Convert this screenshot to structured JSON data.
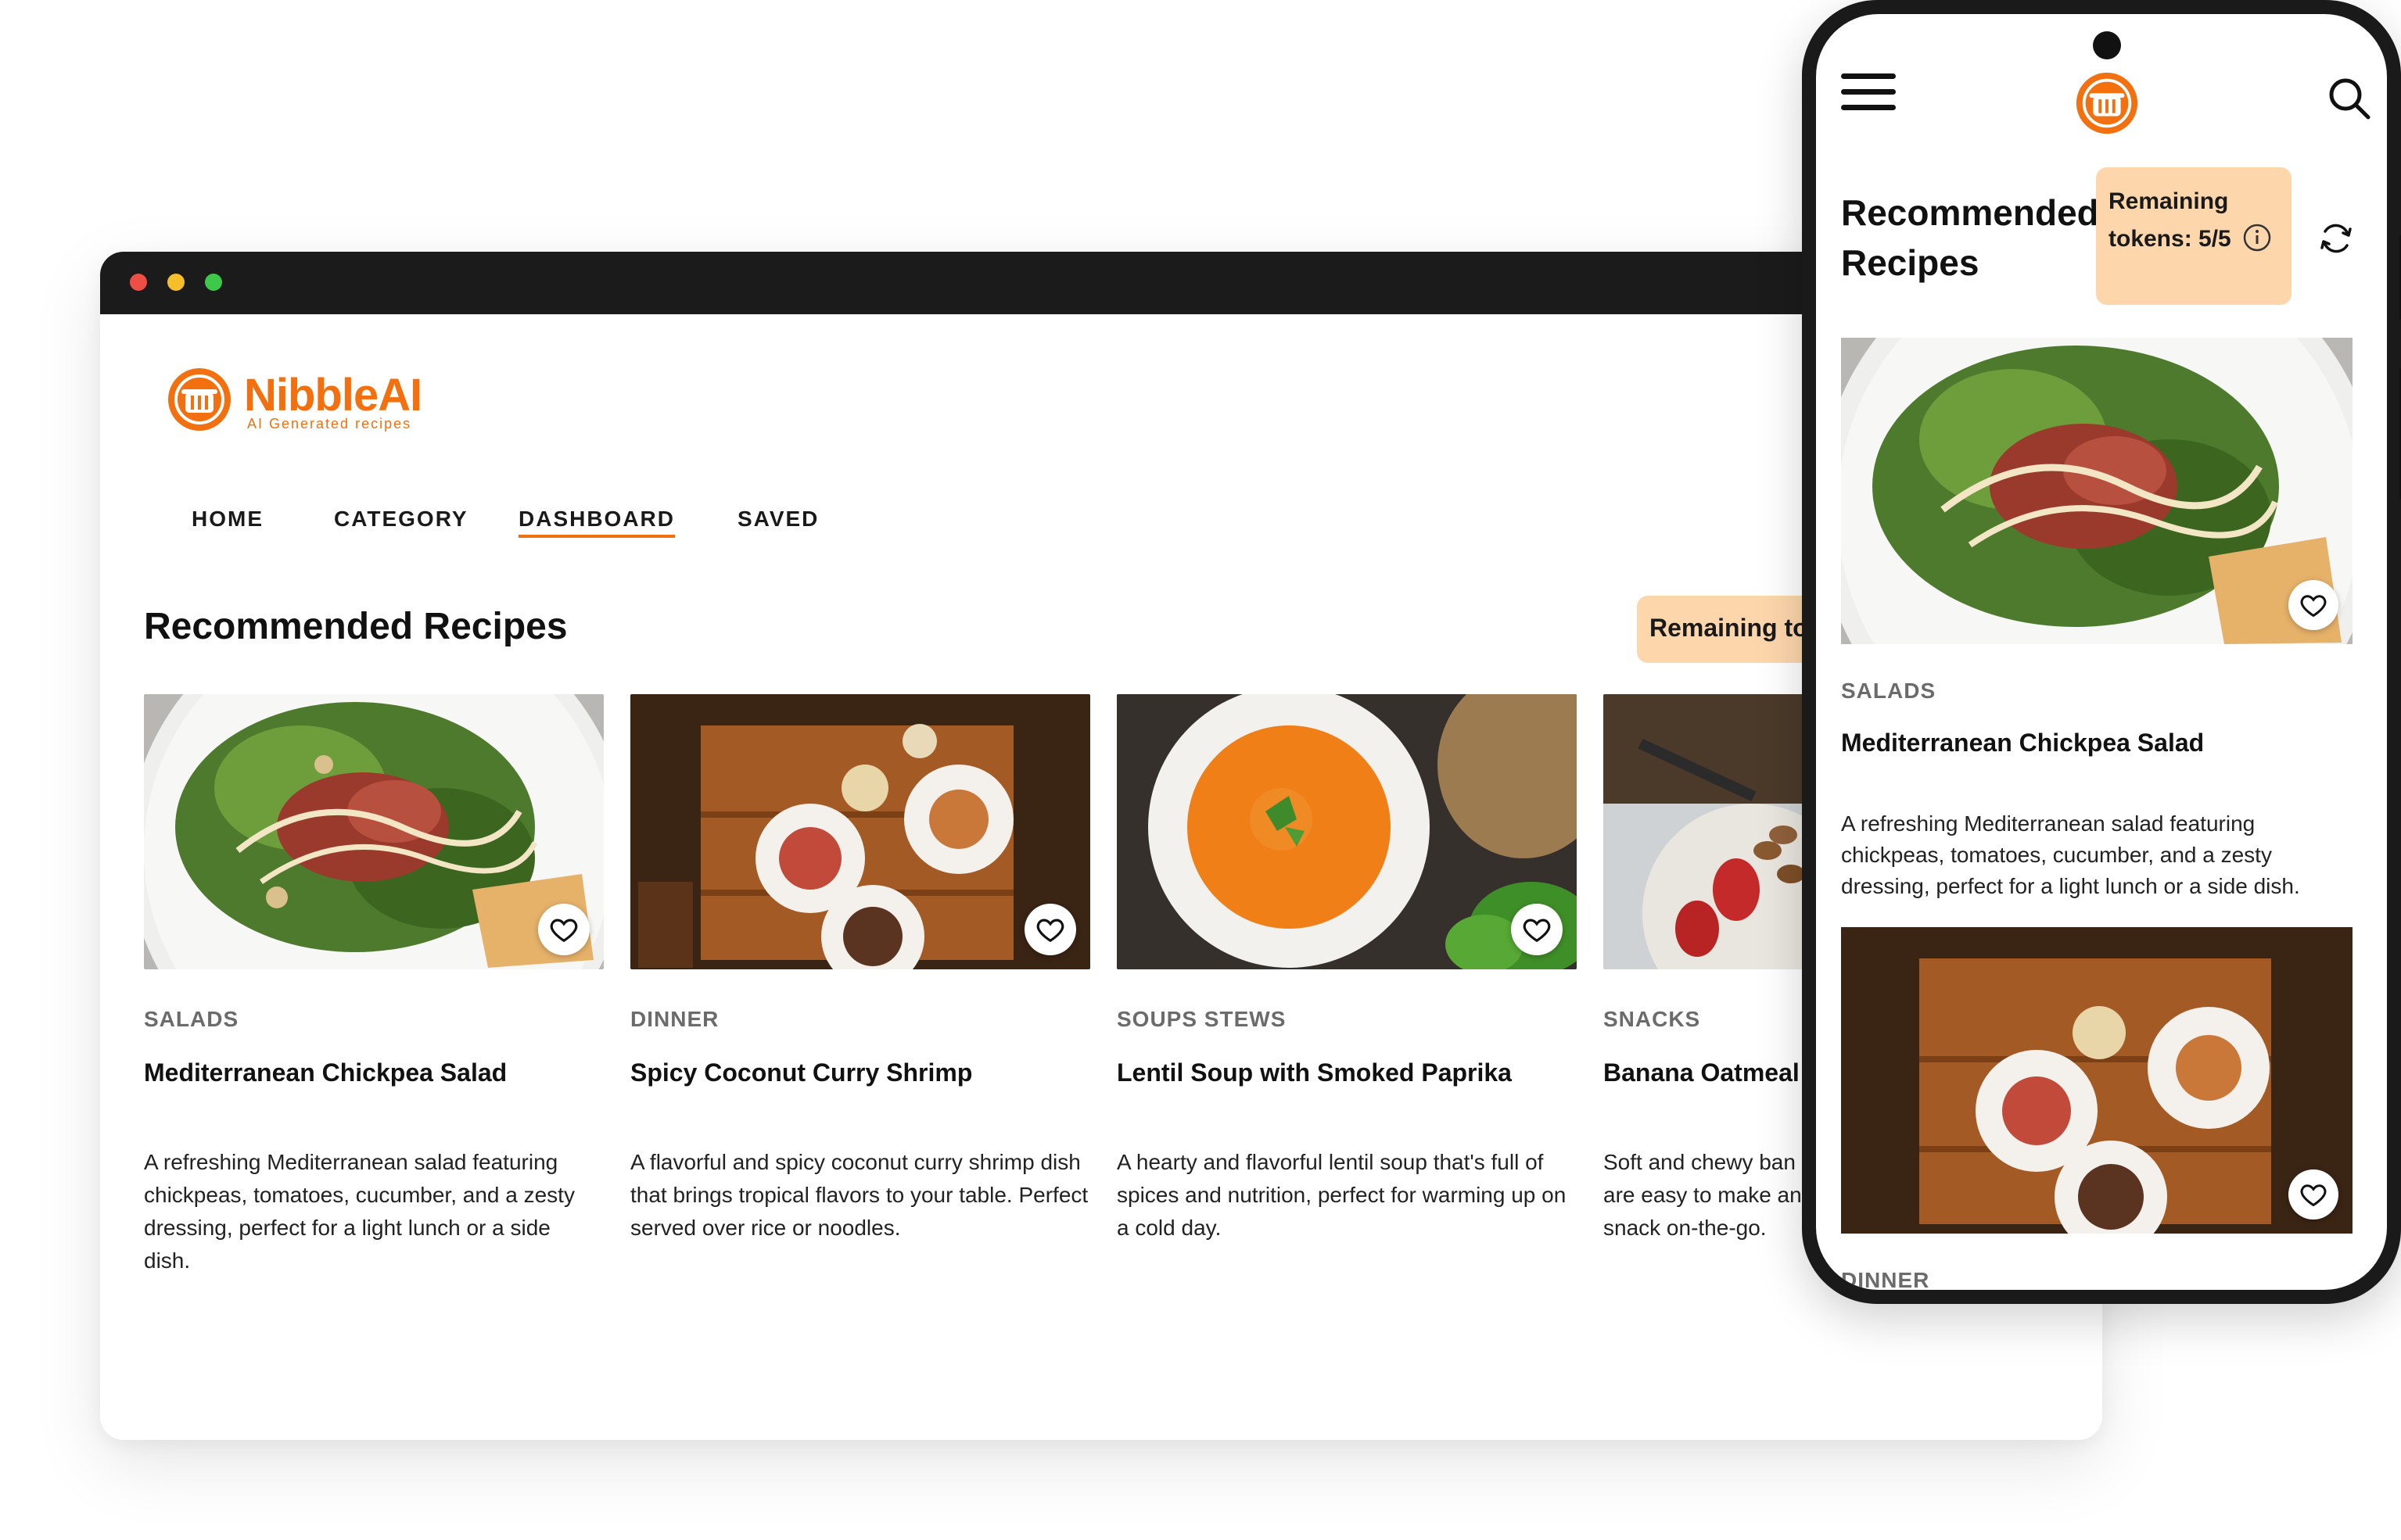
{
  "brand": {
    "name": "NibbleAI",
    "tagline": "AI Generated recipes",
    "color": "#f2700f"
  },
  "nav": {
    "items": [
      {
        "label": "HOME"
      },
      {
        "label": "CATEGORY"
      },
      {
        "label": "DASHBOARD",
        "active": true
      },
      {
        "label": "SAVED"
      }
    ]
  },
  "desktop": {
    "section_title": "Recommended Recipes",
    "tokens_badge": "Remaining tokens: 5/5"
  },
  "recipes": [
    {
      "category": "SALADS",
      "title": "Mediterranean Chickpea Salad",
      "description": "A refreshing Mediterranean salad featuring chickpeas, tomatoes, cucumber, and a zesty dressing, perfect for a light lunch or a side dish.",
      "image": "salad-photo"
    },
    {
      "category": "DINNER",
      "title": "Spicy Coconut Curry Shrimp",
      "description": "A flavorful and spicy coconut curry shrimp dish that brings tropical flavors to your table. Perfect served over rice or noodles.",
      "image": "dinner-table-photo"
    },
    {
      "category": "SOUPS STEWS",
      "title": "Lentil Soup with Smoked Paprika",
      "description": "A hearty and flavorful lentil soup that's full of spices and nutrition, perfect for warming up on a cold day.",
      "image": "soup-photo"
    },
    {
      "category": "SNACKS",
      "title": "Banana Oatmeal",
      "description": "Soft and chewy ban... are easy to make an... snack on-the-go.",
      "description_lines": [
        "Soft and chewy ban",
        "are easy to make an",
        "snack on-the-go."
      ],
      "image": "snacks-photo"
    }
  ],
  "mobile": {
    "section_title": "Recommended Recipes",
    "tokens_label": "Remaining tokens: 5/5",
    "next_category_partial": "DINNER"
  },
  "icons": {
    "menu": "hamburger-menu-icon",
    "search": "search-icon",
    "info": "info-icon",
    "refresh": "refresh-icon",
    "favorite": "heart-icon",
    "logo": "chef-pot-logo-icon"
  },
  "colors": {
    "accent": "#f2700f",
    "token_badge_bg": "#fdd6ac",
    "browser_bar": "#1b1b1b",
    "muted_text": "#6b6b6b"
  }
}
